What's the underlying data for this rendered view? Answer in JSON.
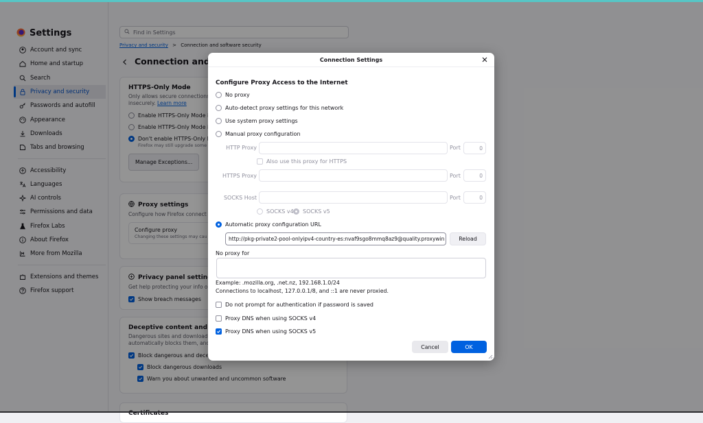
{
  "colors": {
    "accent": "#0061e0",
    "brand": "#ff7139",
    "overlay": "#000000"
  },
  "sidebar": {
    "title": "Settings",
    "brand_icon": "firefox-logo-icon",
    "items": [
      {
        "label": "Account and sync",
        "icon": "account-icon"
      },
      {
        "label": "Home and startup",
        "icon": "home-icon"
      },
      {
        "label": "Search",
        "icon": "search-icon"
      },
      {
        "label": "Privacy and security",
        "icon": "lock-icon",
        "active": true
      },
      {
        "label": "Passwords and autofill",
        "icon": "key-icon"
      },
      {
        "label": "Appearance",
        "icon": "palette-icon"
      },
      {
        "label": "Downloads",
        "icon": "download-icon"
      },
      {
        "label": "Tabs and browsing",
        "icon": "tabs-icon"
      },
      {
        "label": "Accessibility",
        "icon": "accessibility-icon"
      },
      {
        "label": "Languages",
        "icon": "translate-icon"
      },
      {
        "label": "AI controls",
        "icon": "sparkle-icon"
      },
      {
        "label": "Permissions and data",
        "icon": "permissions-icon"
      },
      {
        "label": "Firefox Labs",
        "icon": "flask-icon"
      },
      {
        "label": "About Firefox",
        "icon": "info-icon"
      },
      {
        "label": "More from Mozilla",
        "icon": "mozilla-icon"
      }
    ],
    "footer_items": [
      {
        "label": "Extensions and themes",
        "icon": "puzzle-icon"
      },
      {
        "label": "Firefox support",
        "icon": "help-icon"
      }
    ]
  },
  "main": {
    "search_placeholder": "Find in Settings",
    "breadcrumb": {
      "parent": "Privacy and security",
      "separator": ">",
      "current": "Connection and software security"
    },
    "page_title": "Connection and so",
    "https_only": {
      "title": "HTTPS-Only Mode",
      "desc": "Only allows secure connections",
      "desc2": "insecurely.",
      "learn_more": "Learn more",
      "options": [
        "Enable HTTPS-Only Mode in",
        "Enable HTTPS-Only Mode in",
        "Don't enable HTTPS-Only M"
      ],
      "selected_index": 2,
      "note": "Firefox may still upgrade some c",
      "manage_button": "Manage Exceptions..."
    },
    "proxy": {
      "title": "Proxy settings",
      "desc": "Configure how Firefox connect",
      "configure_title": "Configure proxy",
      "configure_desc": "Changing these settings may cau"
    },
    "privacy_panel": {
      "title": "Privacy panel settings",
      "desc": "Get help protecting your info o",
      "checkbox": "Show breach messages"
    },
    "deceptive": {
      "title": "Deceptive content and dar",
      "desc1": "Dangerous sites and download",
      "desc2": "automatically blocks them, and",
      "cb_main": "Block dangerous and decep",
      "cb_downloads": "Block dangerous downloads",
      "cb_warn": "Warn you about unwanted and uncommon software"
    },
    "certificates_title": "Certificates"
  },
  "dialog": {
    "title": "Connection Settings",
    "heading": "Configure Proxy Access to the Internet",
    "options": {
      "no_proxy": "No proxy",
      "auto_detect": "Auto-detect proxy settings for this network",
      "system": "Use system proxy settings",
      "manual": "Manual proxy configuration",
      "auto_url": "Automatic proxy configuration URL"
    },
    "selected": "auto_url",
    "http_proxy_label": "HTTP Proxy",
    "https_proxy_label": "HTTPS Proxy",
    "socks_host_label": "SOCKS Host",
    "port_label": "Port",
    "port_value": "0",
    "also_https": "Also use this proxy for HTTPS",
    "socks_v4": "SOCKS v4",
    "socks_v5": "SOCKS v5",
    "pac_url": "http://pkg-private2-pool-onlyipv4-country-es:nvaf9sgo8mmq8az9@quality.proxywin",
    "reload": "Reload",
    "no_proxy_for": "No proxy for",
    "no_proxy_value": "",
    "example": "Example: .mozilla.org, .net.nz, 192.168.1.0/24",
    "localhost_note": "Connections to localhost, 127.0.0.1/8, and ::1 are never proxied.",
    "cb_auth": "Do not prompt for authentication if password is saved",
    "cb_dns_v4": "Proxy DNS when using SOCKS v4",
    "cb_dns_v5": "Proxy DNS when using SOCKS v5",
    "cancel": "Cancel",
    "ok": "OK"
  }
}
